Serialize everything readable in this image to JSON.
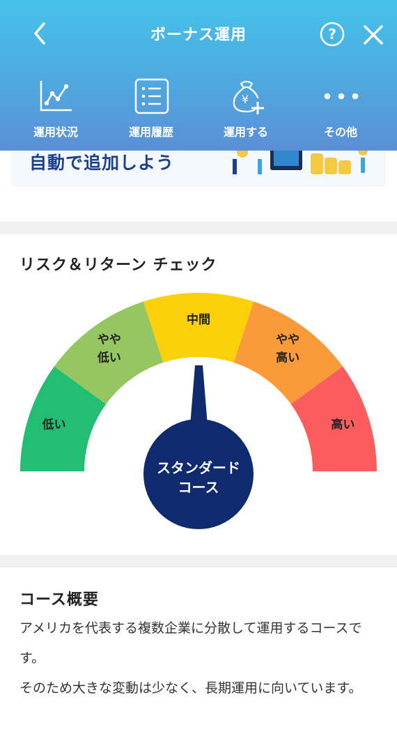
{
  "header": {
    "title": "ボーナス運用",
    "back_icon": "chevron-left-icon",
    "help_icon": "question-circle-icon",
    "close_icon": "close-icon",
    "colors": {
      "top": "#45c2ea",
      "bottom": "#5b8fd6"
    }
  },
  "menu": [
    {
      "label": "運用状況",
      "icon": "line-chart-icon"
    },
    {
      "label": "運用履歴",
      "icon": "list-document-icon"
    },
    {
      "label": "運用する",
      "icon": "money-bag-plus-icon"
    },
    {
      "label": "その他",
      "icon": "more-dots-icon"
    }
  ],
  "banner": {
    "text": "自動で追加しよう"
  },
  "risk_section": {
    "title": "リスク＆リターン チェック",
    "segments": [
      {
        "label": "低い",
        "color": "#22bf73"
      },
      {
        "label": "やや\n低い",
        "color": "#95c662"
      },
      {
        "label": "中間",
        "color": "#fbd008"
      },
      {
        "label": "やや\n高い",
        "color": "#fb9a38"
      },
      {
        "label": "高い",
        "color": "#fb5d5e"
      }
    ],
    "course_label": "スタンダード\nコース",
    "needle_color": "#0f2a6e",
    "selected_level": "中間"
  },
  "course_overview": {
    "title": "コース概要",
    "paragraphs": [
      "アメリカを代表する複数企業に分散して運用するコースです。",
      "そのため大きな変動は少なく、長期運用に向いています。"
    ]
  }
}
